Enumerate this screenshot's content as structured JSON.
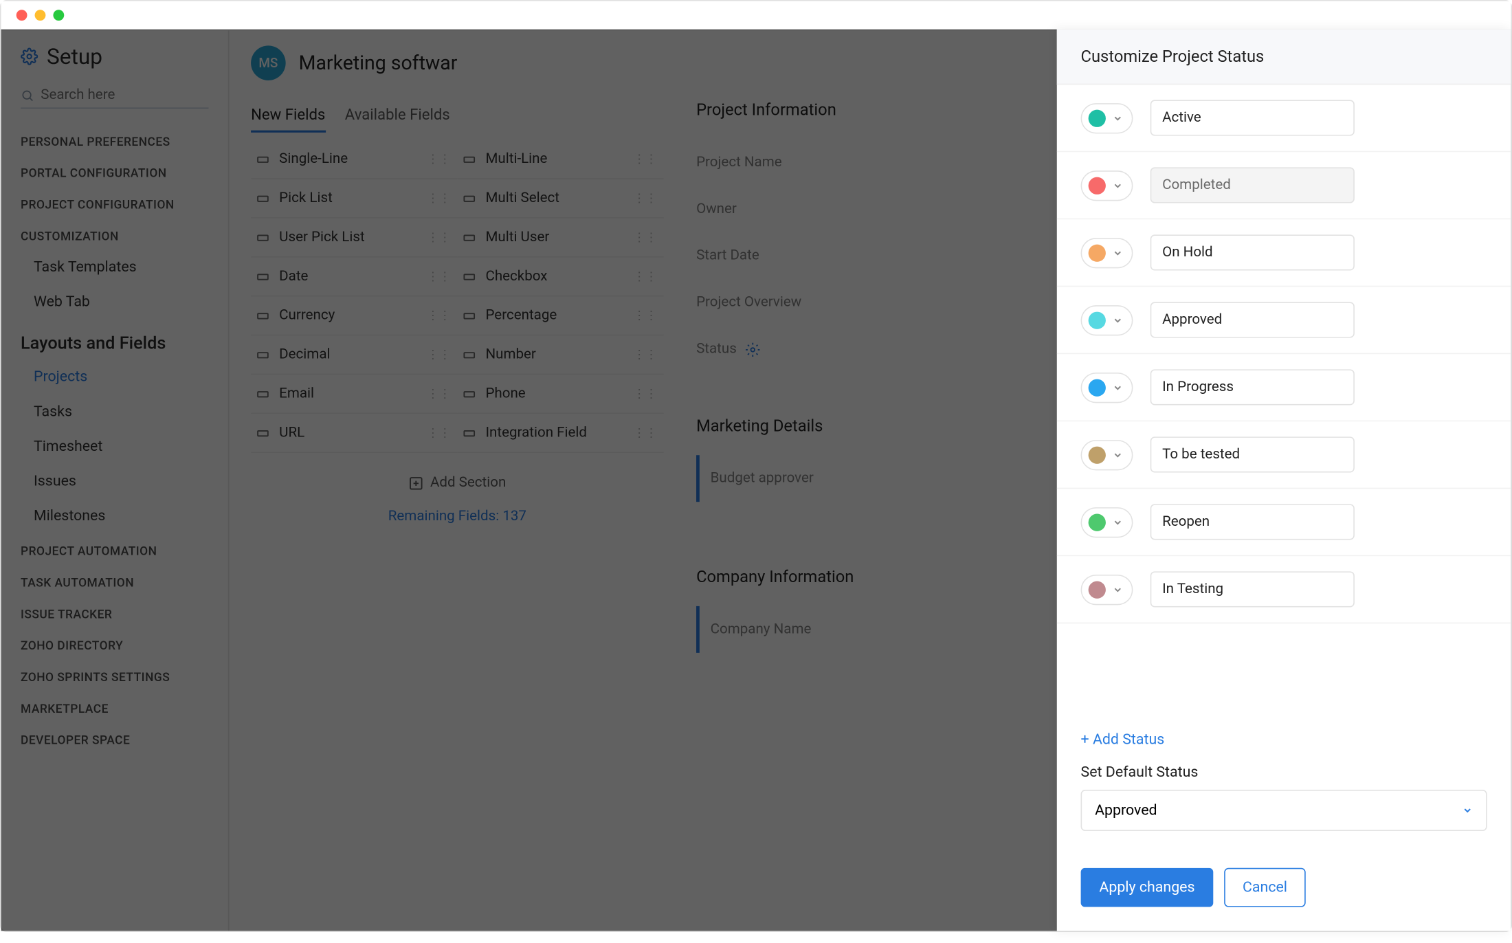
{
  "header": {
    "title": "Setup"
  },
  "search": {
    "placeholder": "Search here"
  },
  "nav": {
    "section_personal": "PERSONAL PREFERENCES",
    "section_portal": "PORTAL CONFIGURATION",
    "section_project": "PROJECT CONFIGURATION",
    "section_custom": "CUSTOMIZATION",
    "custom_task_templates": "Task Templates",
    "custom_web_tab": "Web Tab",
    "section_layouts": "Layouts and Fields",
    "layouts": {
      "projects": "Projects",
      "tasks": "Tasks",
      "timesheet": "Timesheet",
      "issues": "Issues",
      "milestones": "Milestones"
    },
    "section_auto_project": "PROJECT AUTOMATION",
    "section_auto_task": "TASK AUTOMATION",
    "section_issue": "ISSUE TRACKER",
    "section_directory": "ZOHO DIRECTORY",
    "section_sprints": "ZOHO SPRINTS SETTINGS",
    "section_marketplace": "MARKETPLACE",
    "section_developer": "DEVELOPER SPACE"
  },
  "main": {
    "avatar_initials": "MS",
    "title": "Marketing softwar",
    "tabs": {
      "new": "New Fields",
      "available": "Available Fields"
    },
    "fields_left": [
      "Single-Line",
      "Pick List",
      "User Pick List",
      "Date",
      "Currency",
      "Decimal",
      "Email",
      "URL"
    ],
    "fields_right": [
      "Multi-Line",
      "Multi Select",
      "Multi User",
      "Checkbox",
      "Percentage",
      "Number",
      "Phone",
      "Integration Field"
    ],
    "add_section": "Add Section",
    "remaining": "Remaining Fields: 137",
    "project_info_title": "Project Information",
    "project_info": [
      "Project Name",
      "Owner",
      "Start Date",
      "Project Overview",
      "Status"
    ],
    "marketing_title": "Marketing Details",
    "marketing_field": "Budget approver",
    "company_title": "Company Information",
    "company_field": "Company Name"
  },
  "drawer": {
    "title": "Customize Project Status",
    "statuses": [
      {
        "label": "Active",
        "color": "#1fbfa5",
        "readonly": false
      },
      {
        "label": "Completed",
        "color": "#f76a6a",
        "readonly": true
      },
      {
        "label": "On Hold",
        "color": "#f5a864",
        "readonly": false
      },
      {
        "label": "Approved",
        "color": "#57d9e2",
        "readonly": false
      },
      {
        "label": "In Progress",
        "color": "#2aa7f0",
        "readonly": false
      },
      {
        "label": "To be tested",
        "color": "#bfa06a",
        "readonly": false
      },
      {
        "label": "Reopen",
        "color": "#4ec96e",
        "readonly": false
      },
      {
        "label": "In Testing",
        "color": "#c08a8f",
        "readonly": false
      }
    ],
    "add_status": "+ Add Status",
    "default_label": "Set Default Status",
    "default_value": "Approved",
    "apply": "Apply changes",
    "cancel": "Cancel"
  }
}
